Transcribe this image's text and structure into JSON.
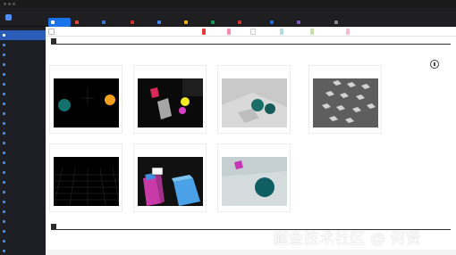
{
  "browser": {
    "tabs": [
      {
        "label": "",
        "color": "#ffffff",
        "active": true
      },
      {
        "label": "",
        "color": "#e8463a"
      },
      {
        "label": "",
        "color": "#3a7bd5"
      },
      {
        "label": "",
        "color": "#d93025"
      },
      {
        "label": "",
        "color": "#4285f4"
      },
      {
        "label": "",
        "color": "#f4b400"
      },
      {
        "label": "",
        "color": "#0f9d58"
      },
      {
        "label": "",
        "color": "#d93025"
      },
      {
        "label": "",
        "color": "#1a73e8"
      },
      {
        "label": "",
        "color": "#7e57c2"
      },
      {
        "label": "",
        "color": "#888888"
      }
    ]
  },
  "app": {
    "brand": ""
  },
  "sidebar": {
    "items": [
      {
        "label": "",
        "num": ""
      },
      {
        "label": "",
        "num": ""
      },
      {
        "label": "",
        "num": ""
      },
      {
        "label": "",
        "num": ""
      },
      {
        "label": "",
        "num": ""
      },
      {
        "label": "",
        "num": ""
      },
      {
        "label": "",
        "num": ""
      },
      {
        "label": "",
        "num": ""
      },
      {
        "label": "",
        "num": ""
      },
      {
        "label": "",
        "num": ""
      },
      {
        "label": "",
        "num": ""
      },
      {
        "label": "",
        "num": ""
      },
      {
        "label": "",
        "num": ""
      },
      {
        "label": "",
        "num": ""
      },
      {
        "label": "",
        "num": ""
      },
      {
        "label": "",
        "num": ""
      },
      {
        "label": "",
        "num": ""
      },
      {
        "label": "",
        "num": ""
      },
      {
        "label": "",
        "num": ""
      },
      {
        "label": "",
        "num": ""
      },
      {
        "label": "",
        "num": ""
      },
      {
        "label": "",
        "num": ""
      },
      {
        "label": "",
        "num": ""
      }
    ],
    "active_index": 0
  },
  "toolbar_chips": [
    {
      "label": "",
      "color": "#e53935"
    },
    {
      "label": "",
      "color": "#f48fb1"
    },
    {
      "label": "",
      "color": "#ffffff"
    },
    {
      "label": "",
      "color": "#b2dfdb"
    },
    {
      "label": "",
      "color": "#c5e1a5"
    },
    {
      "label": "",
      "color": "#f8bbd0"
    }
  ],
  "sections": [
    {
      "header": "",
      "subtitle": ""
    },
    {
      "header": "",
      "subtitle": ""
    }
  ],
  "cards": [
    {
      "title": "",
      "footer": ""
    },
    {
      "title": "",
      "footer": ""
    },
    {
      "title": "",
      "footer": ""
    },
    {
      "title": "",
      "footer": ""
    },
    {
      "title": "",
      "footer": ""
    },
    {
      "title": "",
      "footer": ""
    },
    {
      "title": "",
      "footer": ""
    }
  ],
  "watermark": "掘金技术社区 @ 何贤"
}
